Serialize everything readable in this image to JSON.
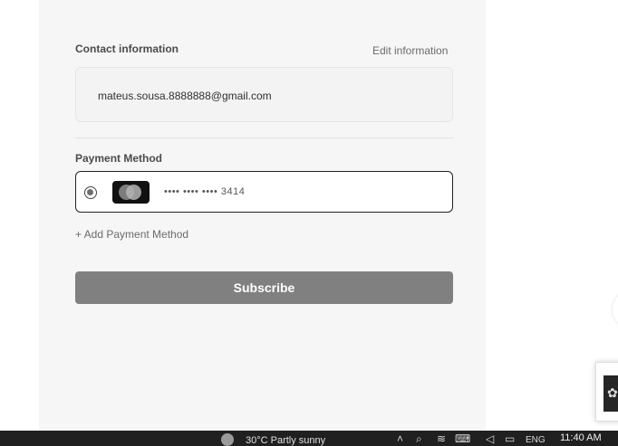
{
  "contact": {
    "heading": "Contact information",
    "edit_label": "Edit information",
    "email": "mateus.sousa.8888888@gmail.com"
  },
  "payment": {
    "heading": "Payment Method",
    "card_number": "•••• •••• •••• 3414",
    "selected": true,
    "add_label": "+ Add Payment Method"
  },
  "actions": {
    "subscribe_label": "Subscribe"
  },
  "taskbar": {
    "weather_text": "30°C  Partly sunny",
    "language": "ENG",
    "time": "11:40 AM"
  },
  "colors": {
    "panel_bg": "#f6f6f6",
    "button_bg": "#808080",
    "taskbar_bg": "#202020",
    "card_border": "#222222"
  },
  "icons": {
    "card": "card-brand-icon",
    "radio": "radio-icon",
    "weather": "weather-icon",
    "chevron": "chevron-up-icon",
    "network": "network-icon",
    "volume": "volume-icon"
  }
}
